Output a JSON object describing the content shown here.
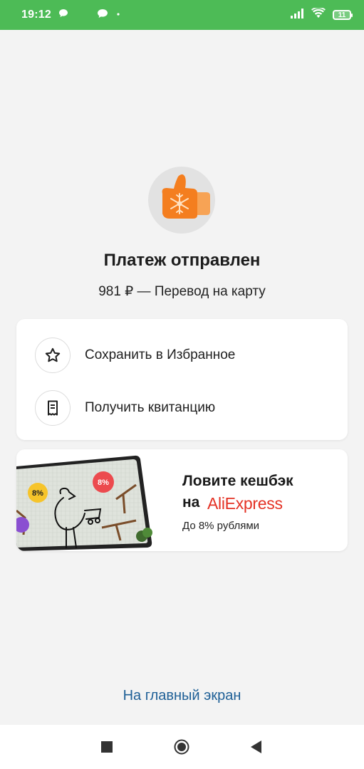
{
  "status_bar": {
    "time": "19:12",
    "battery": "11",
    "icons": [
      "chat-bubble-icon",
      "chat-bubble-icon",
      "dot-icon",
      "signal-icon",
      "wifi-icon",
      "battery-icon"
    ]
  },
  "header": {
    "illustration": "thumbs-up-mitten-icon",
    "title": "Платеж отправлен",
    "subtitle": "981 ₽ — Перевод на карту"
  },
  "actions": [
    {
      "icon": "star-icon",
      "label": "Сохранить в Избранное"
    },
    {
      "icon": "receipt-icon",
      "label": "Получить квитанцию"
    }
  ],
  "promo": {
    "line1": "Ловите кешбэк",
    "line2_prefix": "на",
    "brand": "AliExpress",
    "subtitle": "До 8% рублями",
    "badge_left": "8%",
    "badge_right": "8%"
  },
  "home_link": "На главный экран",
  "nav": [
    "recents-square-icon",
    "home-circle-icon",
    "back-triangle-icon"
  ],
  "colors": {
    "status_bar": "#4dbb56",
    "link": "#1e5f96",
    "brand_red": "#e43225",
    "mitten": "#f47e1f"
  }
}
